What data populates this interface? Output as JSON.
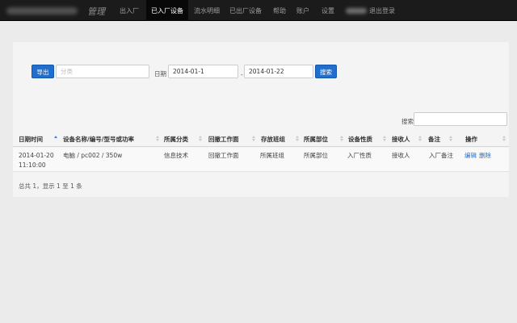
{
  "navbar": {
    "brand": "管理",
    "items": [
      "出入厂",
      "已入厂设备",
      "流水明细",
      "已出厂设备",
      "帮助",
      "账户",
      "设置"
    ],
    "active_index": 1,
    "logout": "退出登录"
  },
  "filters": {
    "export_label": "导出",
    "category_placeholder": "分类",
    "date_label": "日期",
    "date_from": "2014-01-1",
    "date_sep": "-",
    "date_to": "2014-01-22",
    "search_label": "搜索"
  },
  "table": {
    "search_label": "搜索",
    "headers": [
      "日期时间",
      "设备名称/编号/型号或功率",
      "所属分类",
      "回撤工作面",
      "存放班组",
      "所属部位",
      "设备性质",
      "接收人",
      "备注",
      "操作"
    ],
    "rows": [
      {
        "time_date": "2014-01-20",
        "time_clock": "11:10:00",
        "name": "电脑 / pc002 / 350w",
        "category": "信息技术",
        "face": "回撤工作面",
        "team": "所属班组",
        "part": "所属部位",
        "nature": "入厂性质",
        "receiver": "接收人",
        "remark": "入厂备注",
        "edit": "编辑",
        "delete": "删除"
      }
    ]
  },
  "footer": {
    "info": "总共 1，显示 1 至 1 条"
  },
  "colors": {
    "navbar": "#1b1b1b",
    "primary_button": "#1f6fd1",
    "link": "#2a6fc9"
  }
}
